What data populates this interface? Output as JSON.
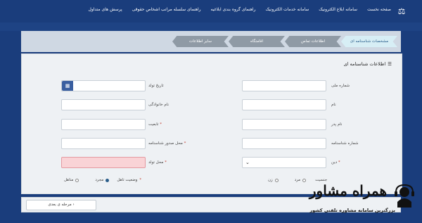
{
  "nav": {
    "items": [
      "صفحه نخست",
      "سامانه ابلاغ الکترونیک",
      "سامانه خدمات الکترونیک",
      "راهنمای گروه بندی ابلاغیه",
      "راهنمای سلسله مراتب اشخاص حقوقی",
      "پرسش های متداول"
    ]
  },
  "tabs": [
    {
      "label": "مشخصات شناسنامه ای",
      "state": "active"
    },
    {
      "label": "اطلاعات تماس",
      "state": "inactive"
    },
    {
      "label": "اقامتگاه",
      "state": "inactive"
    },
    {
      "label": "سایر اطلاعات",
      "state": "inactive"
    }
  ],
  "panel": {
    "title": "اطلاعات شناسنامه ای"
  },
  "fields": {
    "national_id": "شماره ملی",
    "birth_date": "تاریخ تولد",
    "first_name": "نام",
    "last_name": "نام خانوادگی",
    "father_name": "نام پدر",
    "nationality": "تابعیت",
    "id_number": "شماره شناسنامه",
    "id_issue_place": "محل صدور شناسنامه",
    "religion": "دین",
    "birth_place": "محل تولد",
    "gender": "جنسیت",
    "gender_options": [
      "مرد",
      "زن"
    ],
    "marital": "وضعیت تاهل",
    "marital_options": [
      "مجرد",
      "متاهل"
    ],
    "required_mark": "*"
  },
  "footer": {
    "next_button": "مرحله ی بعدی"
  },
  "watermark": {
    "title": "همراه مشاور",
    "subtitle": "بزرگترین سامانه مشاوره تلفنی کشور"
  },
  "colors": {
    "header": "#1a3d7c",
    "active_tab": "#d7eef5",
    "inactive_tab": "#8f9aa5",
    "error_field": "#f9d3d6"
  }
}
